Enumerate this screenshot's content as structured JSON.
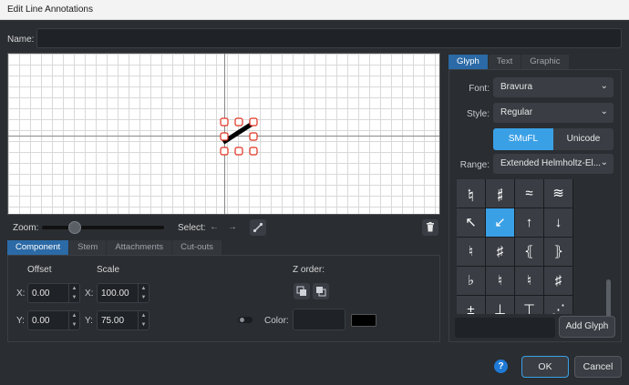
{
  "window": {
    "title": "Edit Line Annotations"
  },
  "name": {
    "label": "Name:",
    "value": ""
  },
  "toolbar": {
    "zoom_label": "Zoom:",
    "zoom_level": 0.27,
    "select_label": "Select:",
    "prev_glyph": "←",
    "next_glyph": "→"
  },
  "component_tabs": [
    "Component",
    "Stem",
    "Attachments",
    "Cut-outs"
  ],
  "component": {
    "offset_label": "Offset",
    "scale_label": "Scale",
    "offset_x_label": "X:",
    "offset_y_label": "Y:",
    "scale_x_label": "X:",
    "scale_y_label": "Y:",
    "offset_x": "0.00",
    "offset_y": "0.00",
    "scale_x": "100.00",
    "scale_y": "75.00",
    "z_order_label": "Z order:",
    "color_label": "Color:"
  },
  "right_tabs": [
    "Glyph",
    "Text",
    "Graphic"
  ],
  "glyph": {
    "font_label": "Font:",
    "font_value": "Bravura",
    "style_label": "Style:",
    "style_value": "Regular",
    "smufl_label": "SMuFL",
    "unicode_label": "Unicode",
    "range_label": "Range:",
    "range_value": "Extended Helmholtz-El...",
    "grid": [
      [
        "𝄮",
        "𝄰",
        "≈",
        "≋"
      ],
      [
        "↖",
        "↙",
        "↑",
        "↓"
      ],
      [
        "♮",
        "♯",
        "⦃",
        "⦄"
      ],
      [
        "♭",
        "♮",
        "♮",
        "♯"
      ],
      [
        "±",
        "⊥",
        "⊤",
        "⋰"
      ]
    ],
    "selected_index": [
      1,
      1
    ],
    "add_label": "Add Glyph"
  },
  "footer": {
    "help": "?",
    "ok_label": "OK",
    "cancel_label": "Cancel"
  },
  "colors": {
    "accent": "#3aa0e6",
    "tab_active": "#2b6aa6",
    "handle": "#e0301e"
  }
}
